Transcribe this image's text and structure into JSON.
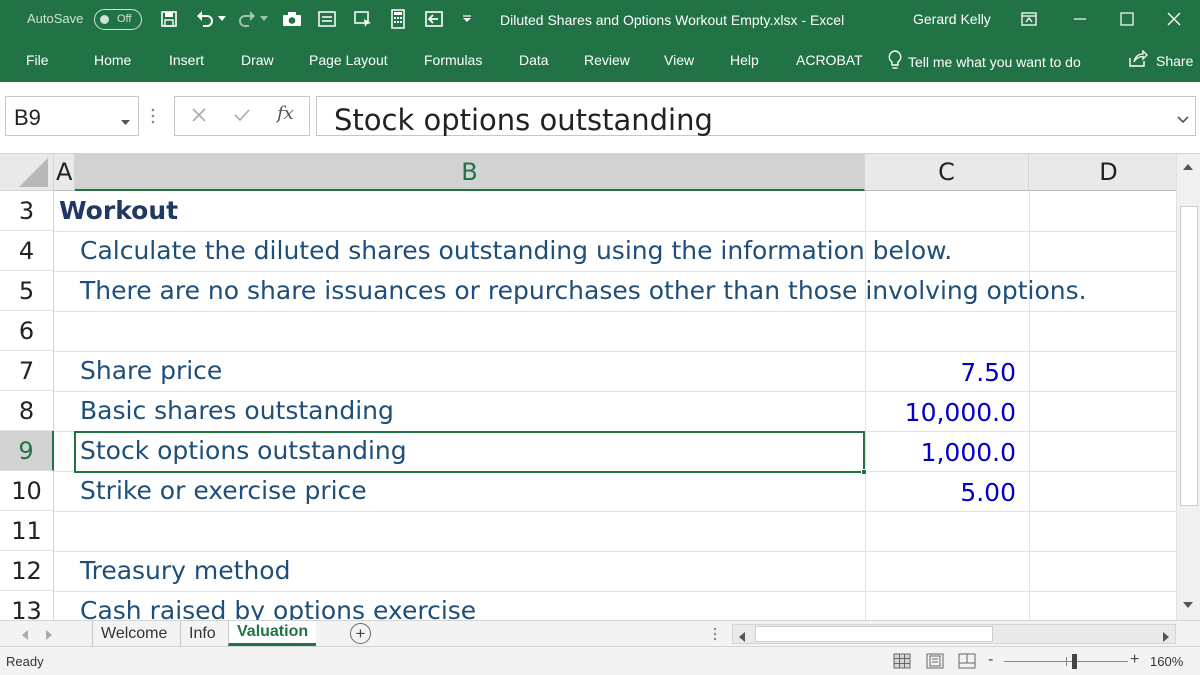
{
  "colors": {
    "accent": "#217346",
    "cell_text": "#1f4e79",
    "cell_number": "#0000c8",
    "title_text": "#1f3864"
  },
  "titlebar": {
    "autosave_label": "AutoSave",
    "autosave_state": "Off",
    "document_title": "Diluted Shares and Options Workout Empty.xlsx  -  Excel",
    "user_name": "Gerard Kelly",
    "icons": [
      "save-icon",
      "undo-icon",
      "redo-icon",
      "camera-icon",
      "form-icon",
      "shape-icon",
      "calculator-icon",
      "import-icon",
      "customize-dropdown-icon",
      "ribbon-display-icon",
      "minimize-icon",
      "maximize-icon",
      "close-icon"
    ]
  },
  "ribbon": {
    "tabs": [
      "File",
      "Home",
      "Insert",
      "Draw",
      "Page Layout",
      "Formulas",
      "Data",
      "Review",
      "View",
      "Help",
      "ACROBAT"
    ],
    "tell_me": "Tell me what you want to do",
    "share": "Share"
  },
  "formula_bar": {
    "name_box": "B9",
    "function_label": "fx",
    "content": "Stock options outstanding"
  },
  "grid": {
    "columns": [
      "A",
      "B",
      "C",
      "D"
    ],
    "selected_column": "B",
    "rows": [
      {
        "num": "3",
        "a": "Workout",
        "b": "",
        "c": ""
      },
      {
        "num": "4",
        "a": "",
        "b": "Calculate the diluted shares outstanding using the information below.",
        "c": ""
      },
      {
        "num": "5",
        "a": "",
        "b": "There are no share issuances or repurchases other than those involving options.",
        "c": ""
      },
      {
        "num": "6",
        "a": "",
        "b": "",
        "c": ""
      },
      {
        "num": "7",
        "a": "",
        "b": "Share price",
        "c": "7.50"
      },
      {
        "num": "8",
        "a": "",
        "b": "Basic shares outstanding",
        "c": "10,000.0"
      },
      {
        "num": "9",
        "a": "",
        "b": "Stock options outstanding",
        "c": "1,000.0"
      },
      {
        "num": "10",
        "a": "",
        "b": "Strike or exercise price",
        "c": "5.00"
      },
      {
        "num": "11",
        "a": "",
        "b": "",
        "c": ""
      },
      {
        "num": "12",
        "a": "",
        "b": "Treasury method",
        "c": ""
      },
      {
        "num": "13",
        "a": "",
        "b": "Cash raised by options exercise",
        "c": ""
      }
    ],
    "selected_row": "9"
  },
  "sheets": {
    "tabs": [
      "Welcome",
      "Info",
      "Valuation"
    ],
    "active": "Valuation",
    "add_label": "+"
  },
  "status": {
    "text": "Ready",
    "zoom_minus": "-",
    "zoom_plus": "+",
    "zoom_level": "160%"
  }
}
